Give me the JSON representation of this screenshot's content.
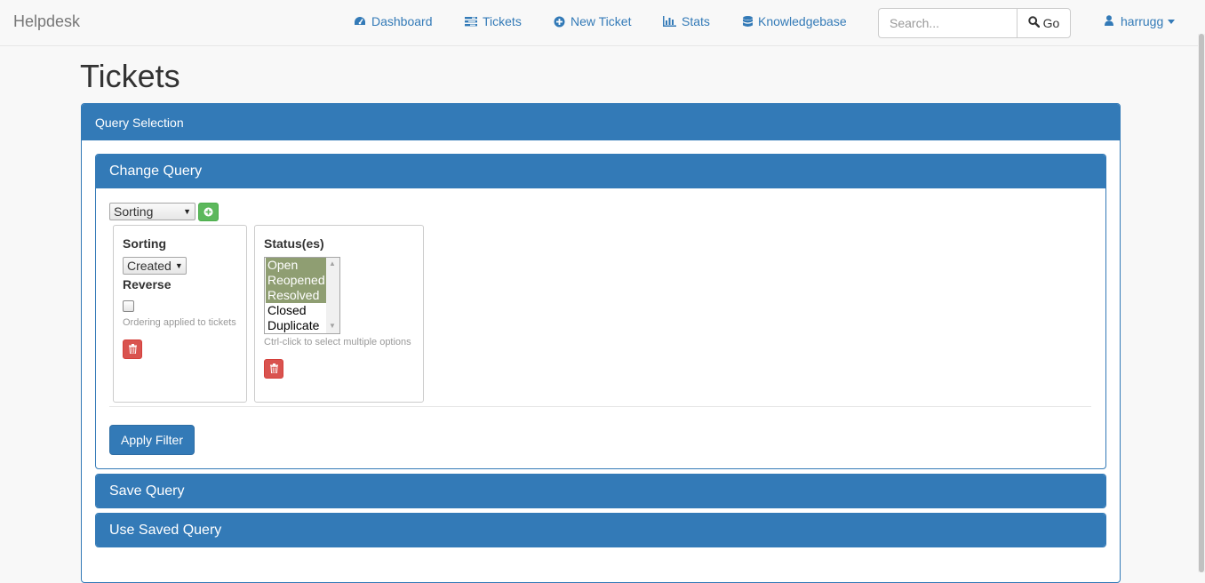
{
  "navbar": {
    "brand": "Helpdesk",
    "items": [
      {
        "label": "Dashboard",
        "icon": "dashboard-icon"
      },
      {
        "label": "Tickets",
        "icon": "tasks-icon"
      },
      {
        "label": "New Ticket",
        "icon": "plus-circle-icon"
      },
      {
        "label": "Stats",
        "icon": "bar-chart-icon"
      },
      {
        "label": "Knowledgebase",
        "icon": "database-icon"
      }
    ],
    "search": {
      "placeholder": "Search...",
      "value": "",
      "button_label": "Go"
    },
    "user": {
      "name": "harrugg",
      "icon": "user-icon"
    }
  },
  "page": {
    "title": "Tickets"
  },
  "query_panel": {
    "heading": "Query Selection",
    "change_query": {
      "heading": "Change Query",
      "filter_select": {
        "selected": "Sorting"
      },
      "sorting": {
        "title": "Sorting",
        "sort_select": {
          "selected": "Created"
        },
        "reverse_label": "Reverse",
        "reverse_checked": false,
        "help": "Ordering applied to tickets"
      },
      "statuses": {
        "title": "Status(es)",
        "options": [
          {
            "label": "Open",
            "selected": true
          },
          {
            "label": "Reopened",
            "selected": true
          },
          {
            "label": "Resolved",
            "selected": true
          },
          {
            "label": "Closed",
            "selected": false
          },
          {
            "label": "Duplicate",
            "selected": false
          }
        ],
        "help": "Ctrl-click to select multiple options"
      },
      "apply_label": "Apply Filter"
    },
    "save_query": {
      "heading": "Save Query"
    },
    "use_saved_query": {
      "heading": "Use Saved Query"
    }
  },
  "colors": {
    "primary": "#337ab7",
    "success": "#5cb85c",
    "danger": "#d9534f",
    "selected_option": "#8f9e72"
  }
}
